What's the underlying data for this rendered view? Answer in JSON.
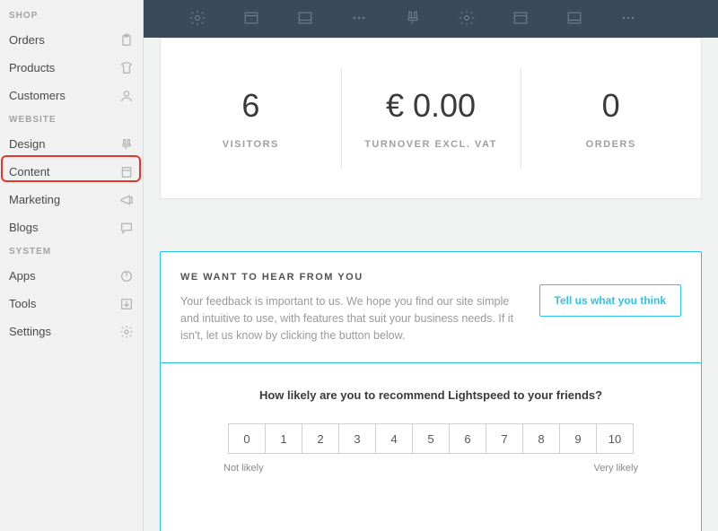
{
  "sidebar": {
    "sections": [
      {
        "header": "SHOP",
        "items": [
          {
            "label": "Orders",
            "icon": "clipboard-icon"
          },
          {
            "label": "Products",
            "icon": "tshirt-icon"
          },
          {
            "label": "Customers",
            "icon": "user-icon"
          }
        ]
      },
      {
        "header": "WEBSITE",
        "items": [
          {
            "label": "Design",
            "icon": "brush-icon"
          },
          {
            "label": "Content",
            "icon": "page-icon"
          },
          {
            "label": "Marketing",
            "icon": "megaphone-icon"
          },
          {
            "label": "Blogs",
            "icon": "chat-icon"
          }
        ]
      },
      {
        "header": "SYSTEM",
        "items": [
          {
            "label": "Apps",
            "icon": "power-icon"
          },
          {
            "label": "Tools",
            "icon": "export-icon"
          },
          {
            "label": "Settings",
            "icon": "gear-icon"
          }
        ]
      }
    ]
  },
  "stats": [
    {
      "value": "6",
      "label": "VISITORS"
    },
    {
      "value": "€ 0.00",
      "label": "TURNOVER EXCL. VAT"
    },
    {
      "value": "0",
      "label": "ORDERS"
    }
  ],
  "feedback": {
    "title": "WE WANT TO HEAR FROM YOU",
    "text": "Your feedback is important to us. We hope you find our site simple and intuitive to use, with features that suit your business needs. If it isn't, let us know by clicking the button below.",
    "button": "Tell us what you think"
  },
  "nps": {
    "question": "How likely are you to recommend Lightspeed to your friends?",
    "options": [
      "0",
      "1",
      "2",
      "3",
      "4",
      "5",
      "6",
      "7",
      "8",
      "9",
      "10"
    ],
    "low_label": "Not likely",
    "high_label": "Very likely"
  },
  "colors": {
    "accent": "#2dc3e8",
    "highlight": "#e4392a",
    "topbar": "#394b5b"
  }
}
